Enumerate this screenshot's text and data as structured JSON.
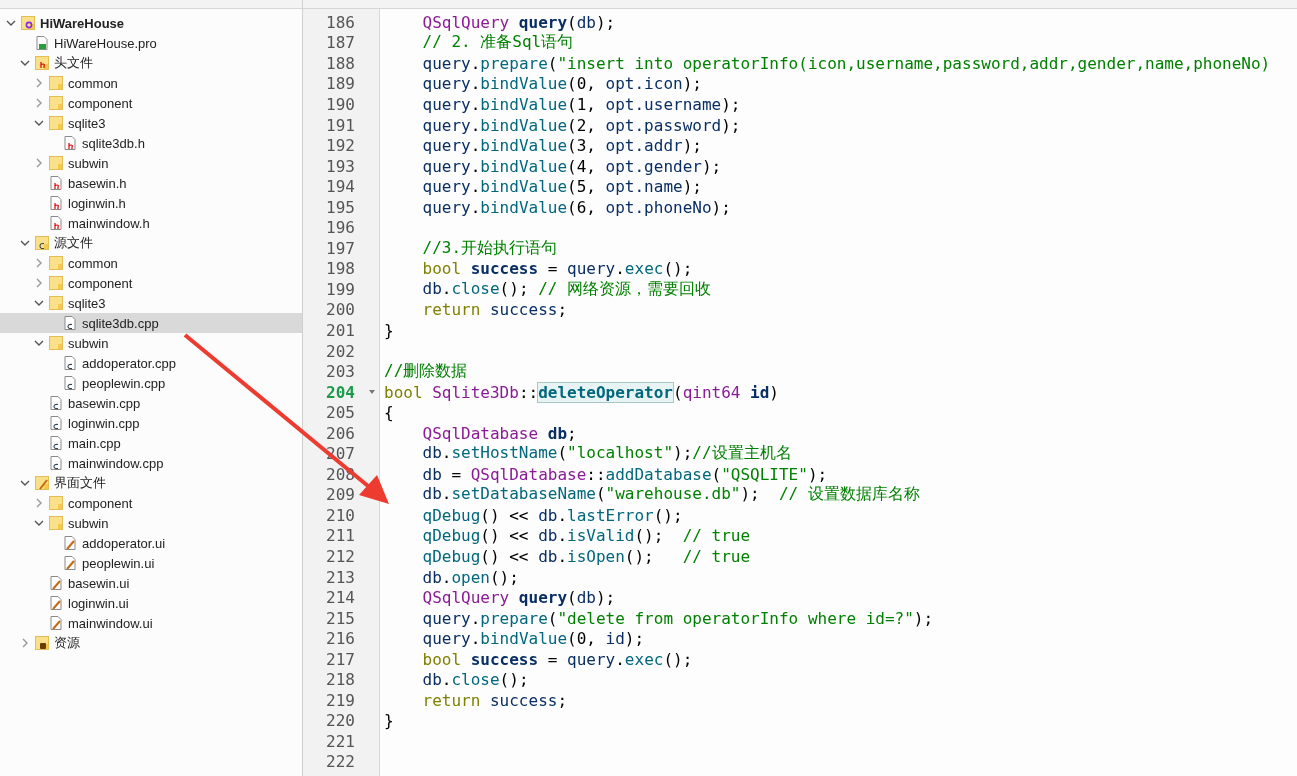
{
  "project_tree": [
    {
      "label": "HiWareHouse",
      "kind": "project",
      "expanded": true,
      "selected": false,
      "children": [
        {
          "label": "HiWareHouse.pro",
          "kind": "pro",
          "selected": false
        },
        {
          "label": "头文件",
          "kind": "headers",
          "expanded": true,
          "selected": false,
          "children": [
            {
              "label": "common",
              "kind": "folder",
              "expanded": false,
              "selected": false
            },
            {
              "label": "component",
              "kind": "folder",
              "expanded": false,
              "selected": false
            },
            {
              "label": "sqlite3",
              "kind": "folder",
              "expanded": true,
              "selected": false,
              "children": [
                {
                  "label": "sqlite3db.h",
                  "kind": "header",
                  "selected": false
                }
              ]
            },
            {
              "label": "subwin",
              "kind": "folder",
              "expanded": false,
              "selected": false
            },
            {
              "label": "basewin.h",
              "kind": "header",
              "selected": false
            },
            {
              "label": "loginwin.h",
              "kind": "header",
              "selected": false
            },
            {
              "label": "mainwindow.h",
              "kind": "header",
              "selected": false
            }
          ]
        },
        {
          "label": "源文件",
          "kind": "sources",
          "expanded": true,
          "selected": false,
          "children": [
            {
              "label": "common",
              "kind": "folder",
              "expanded": false,
              "selected": false
            },
            {
              "label": "component",
              "kind": "folder",
              "expanded": false,
              "selected": false
            },
            {
              "label": "sqlite3",
              "kind": "folder",
              "expanded": true,
              "selected": false,
              "children": [
                {
                  "label": "sqlite3db.cpp",
                  "kind": "source",
                  "selected": true
                }
              ]
            },
            {
              "label": "subwin",
              "kind": "folder",
              "expanded": true,
              "selected": false,
              "children": [
                {
                  "label": "addoperator.cpp",
                  "kind": "source",
                  "selected": false
                },
                {
                  "label": "peoplewin.cpp",
                  "kind": "source",
                  "selected": false
                }
              ]
            },
            {
              "label": "basewin.cpp",
              "kind": "source",
              "selected": false
            },
            {
              "label": "loginwin.cpp",
              "kind": "source",
              "selected": false
            },
            {
              "label": "main.cpp",
              "kind": "source",
              "selected": false
            },
            {
              "label": "mainwindow.cpp",
              "kind": "source",
              "selected": false
            }
          ]
        },
        {
          "label": "界面文件",
          "kind": "forms",
          "expanded": true,
          "selected": false,
          "children": [
            {
              "label": "component",
              "kind": "folder",
              "expanded": false,
              "selected": false
            },
            {
              "label": "subwin",
              "kind": "folder",
              "expanded": true,
              "selected": false,
              "children": [
                {
                  "label": "addoperator.ui",
                  "kind": "form",
                  "selected": false
                },
                {
                  "label": "peoplewin.ui",
                  "kind": "form",
                  "selected": false
                }
              ]
            },
            {
              "label": "basewin.ui",
              "kind": "form",
              "selected": false
            },
            {
              "label": "loginwin.ui",
              "kind": "form",
              "selected": false
            },
            {
              "label": "mainwindow.ui",
              "kind": "form",
              "selected": false
            }
          ]
        },
        {
          "label": "资源",
          "kind": "resources",
          "expanded": false,
          "selected": false
        }
      ]
    }
  ],
  "editor": {
    "lines": [
      {
        "number": "186",
        "current": false,
        "foldable": false,
        "indented": true,
        "tokens": [
          {
            "kind": "type",
            "text": "QSqlQuery "
          },
          {
            "kind": "decl",
            "text": "query"
          },
          {
            "kind": "plain",
            "text": "("
          },
          {
            "kind": "var",
            "text": "db"
          },
          {
            "kind": "plain",
            "text": ");"
          }
        ]
      },
      {
        "number": "187",
        "current": false,
        "foldable": false,
        "indented": true,
        "tokens": [
          {
            "kind": "comment",
            "text": "// 2. 准备Sql语句"
          }
        ]
      },
      {
        "number": "188",
        "current": false,
        "foldable": false,
        "indented": true,
        "tokens": [
          {
            "kind": "var",
            "text": "query"
          },
          {
            "kind": "plain",
            "text": "."
          },
          {
            "kind": "fn",
            "text": "prepare"
          },
          {
            "kind": "plain",
            "text": "("
          },
          {
            "kind": "string",
            "text": "\"insert into operatorInfo(icon,username,password,addr,gender,name,phoneNo)"
          }
        ]
      },
      {
        "number": "189",
        "current": false,
        "foldable": false,
        "indented": true,
        "tokens": [
          {
            "kind": "var",
            "text": "query"
          },
          {
            "kind": "plain",
            "text": "."
          },
          {
            "kind": "fn",
            "text": "bindValue"
          },
          {
            "kind": "plain",
            "text": "(0, "
          },
          {
            "kind": "var",
            "text": "opt.icon"
          },
          {
            "kind": "plain",
            "text": ");"
          }
        ]
      },
      {
        "number": "190",
        "current": false,
        "foldable": false,
        "indented": true,
        "tokens": [
          {
            "kind": "var",
            "text": "query"
          },
          {
            "kind": "plain",
            "text": "."
          },
          {
            "kind": "fn",
            "text": "bindValue"
          },
          {
            "kind": "plain",
            "text": "(1, "
          },
          {
            "kind": "var",
            "text": "opt.username"
          },
          {
            "kind": "plain",
            "text": ");"
          }
        ]
      },
      {
        "number": "191",
        "current": false,
        "foldable": false,
        "indented": true,
        "tokens": [
          {
            "kind": "var",
            "text": "query"
          },
          {
            "kind": "plain",
            "text": "."
          },
          {
            "kind": "fn",
            "text": "bindValue"
          },
          {
            "kind": "plain",
            "text": "(2, "
          },
          {
            "kind": "var",
            "text": "opt.password"
          },
          {
            "kind": "plain",
            "text": ");"
          }
        ]
      },
      {
        "number": "192",
        "current": false,
        "foldable": false,
        "indented": true,
        "tokens": [
          {
            "kind": "var",
            "text": "query"
          },
          {
            "kind": "plain",
            "text": "."
          },
          {
            "kind": "fn",
            "text": "bindValue"
          },
          {
            "kind": "plain",
            "text": "(3, "
          },
          {
            "kind": "var",
            "text": "opt.addr"
          },
          {
            "kind": "plain",
            "text": ");"
          }
        ]
      },
      {
        "number": "193",
        "current": false,
        "foldable": false,
        "indented": true,
        "tokens": [
          {
            "kind": "var",
            "text": "query"
          },
          {
            "kind": "plain",
            "text": "."
          },
          {
            "kind": "fn",
            "text": "bindValue"
          },
          {
            "kind": "plain",
            "text": "(4, "
          },
          {
            "kind": "var",
            "text": "opt.gender"
          },
          {
            "kind": "plain",
            "text": ");"
          }
        ]
      },
      {
        "number": "194",
        "current": false,
        "foldable": false,
        "indented": true,
        "tokens": [
          {
            "kind": "var",
            "text": "query"
          },
          {
            "kind": "plain",
            "text": "."
          },
          {
            "kind": "fn",
            "text": "bindValue"
          },
          {
            "kind": "plain",
            "text": "(5, "
          },
          {
            "kind": "var",
            "text": "opt.name"
          },
          {
            "kind": "plain",
            "text": ");"
          }
        ]
      },
      {
        "number": "195",
        "current": false,
        "foldable": false,
        "indented": true,
        "tokens": [
          {
            "kind": "var",
            "text": "query"
          },
          {
            "kind": "plain",
            "text": "."
          },
          {
            "kind": "fn",
            "text": "bindValue"
          },
          {
            "kind": "plain",
            "text": "(6, "
          },
          {
            "kind": "var",
            "text": "opt.phoneNo"
          },
          {
            "kind": "plain",
            "text": ");"
          }
        ]
      },
      {
        "number": "196",
        "current": false
      },
      {
        "number": "197",
        "current": false,
        "foldable": false,
        "indented": true,
        "tokens": [
          {
            "kind": "comment",
            "text": "//3.开始执行语句"
          }
        ]
      },
      {
        "number": "198",
        "current": false,
        "foldable": false,
        "indented": true,
        "tokens": [
          {
            "kind": "keyword",
            "text": "bool "
          },
          {
            "kind": "decl",
            "text": "success"
          },
          {
            "kind": "plain",
            "text": " = "
          },
          {
            "kind": "var",
            "text": "query"
          },
          {
            "kind": "plain",
            "text": "."
          },
          {
            "kind": "fn",
            "text": "exec"
          },
          {
            "kind": "plain",
            "text": "();"
          }
        ]
      },
      {
        "number": "199",
        "current": false,
        "foldable": false,
        "indented": true,
        "tokens": [
          {
            "kind": "var",
            "text": "db"
          },
          {
            "kind": "plain",
            "text": "."
          },
          {
            "kind": "fn",
            "text": "close"
          },
          {
            "kind": "plain",
            "text": "(); "
          },
          {
            "kind": "comment",
            "text": "// 网络资源，需要回收"
          }
        ]
      },
      {
        "number": "200",
        "current": false,
        "foldable": false,
        "indented": true,
        "tokens": [
          {
            "kind": "keyword",
            "text": "return "
          },
          {
            "kind": "var",
            "text": "success"
          },
          {
            "kind": "plain",
            "text": ";"
          }
        ]
      },
      {
        "number": "201",
        "current": false,
        "foldable": false,
        "indented": false,
        "tokens": [
          {
            "kind": "plain",
            "text": "}"
          }
        ]
      },
      {
        "number": "202",
        "current": false
      },
      {
        "number": "203",
        "current": false,
        "foldable": false,
        "indented": false,
        "tokens": [
          {
            "kind": "comment",
            "text": "//删除数据"
          }
        ]
      },
      {
        "number": "204",
        "current": true,
        "foldable": true,
        "indented": false,
        "tokens": [
          {
            "kind": "keyword",
            "text": "bool "
          },
          {
            "kind": "type",
            "text": "Sqlite3Db"
          },
          {
            "kind": "plain",
            "text": "::"
          },
          {
            "kind": "match",
            "text": "deleteOperator"
          },
          {
            "kind": "plain",
            "text": "("
          },
          {
            "kind": "type",
            "text": "qint64 "
          },
          {
            "kind": "decl",
            "text": "id"
          },
          {
            "kind": "plain",
            "text": ")"
          }
        ]
      },
      {
        "number": "205",
        "current": false,
        "foldable": false,
        "indented": false,
        "tokens": [
          {
            "kind": "plain",
            "text": "{"
          }
        ]
      },
      {
        "number": "206",
        "current": false,
        "foldable": false,
        "indented": true,
        "tokens": [
          {
            "kind": "type",
            "text": "QSqlDatabase "
          },
          {
            "kind": "decl",
            "text": "db"
          },
          {
            "kind": "plain",
            "text": ";"
          }
        ]
      },
      {
        "number": "207",
        "current": false,
        "foldable": false,
        "indented": true,
        "tokens": [
          {
            "kind": "var",
            "text": "db"
          },
          {
            "kind": "plain",
            "text": "."
          },
          {
            "kind": "fn",
            "text": "setHostName"
          },
          {
            "kind": "plain",
            "text": "("
          },
          {
            "kind": "string",
            "text": "\"localhost\""
          },
          {
            "kind": "plain",
            "text": ");"
          },
          {
            "kind": "comment",
            "text": "//设置主机名"
          }
        ]
      },
      {
        "number": "208",
        "current": false,
        "foldable": false,
        "indented": true,
        "tokens": [
          {
            "kind": "var",
            "text": "db"
          },
          {
            "kind": "plain",
            "text": " = "
          },
          {
            "kind": "type",
            "text": "QSqlDatabase"
          },
          {
            "kind": "plain",
            "text": "::"
          },
          {
            "kind": "fn",
            "text": "addDatabase"
          },
          {
            "kind": "plain",
            "text": "("
          },
          {
            "kind": "string",
            "text": "\"QSQLITE\""
          },
          {
            "kind": "plain",
            "text": ");"
          }
        ]
      },
      {
        "number": "209",
        "current": false,
        "foldable": false,
        "indented": true,
        "tokens": [
          {
            "kind": "var",
            "text": "db"
          },
          {
            "kind": "plain",
            "text": "."
          },
          {
            "kind": "fn",
            "text": "setDatabaseName"
          },
          {
            "kind": "plain",
            "text": "("
          },
          {
            "kind": "string",
            "text": "\"warehouse.db\""
          },
          {
            "kind": "plain",
            "text": ");  "
          },
          {
            "kind": "comment",
            "text": "// 设置数据库名称"
          }
        ]
      },
      {
        "number": "210",
        "current": false,
        "foldable": false,
        "indented": true,
        "tokens": [
          {
            "kind": "fn",
            "text": "qDebug"
          },
          {
            "kind": "plain",
            "text": "() << "
          },
          {
            "kind": "var",
            "text": "db"
          },
          {
            "kind": "plain",
            "text": "."
          },
          {
            "kind": "fn",
            "text": "lastError"
          },
          {
            "kind": "plain",
            "text": "();"
          }
        ]
      },
      {
        "number": "211",
        "current": false,
        "foldable": false,
        "indented": true,
        "tokens": [
          {
            "kind": "fn",
            "text": "qDebug"
          },
          {
            "kind": "plain",
            "text": "() << "
          },
          {
            "kind": "var",
            "text": "db"
          },
          {
            "kind": "plain",
            "text": "."
          },
          {
            "kind": "fn",
            "text": "isValid"
          },
          {
            "kind": "plain",
            "text": "();  "
          },
          {
            "kind": "comment",
            "text": "// true"
          }
        ]
      },
      {
        "number": "212",
        "current": false,
        "foldable": false,
        "indented": true,
        "tokens": [
          {
            "kind": "fn",
            "text": "qDebug"
          },
          {
            "kind": "plain",
            "text": "() << "
          },
          {
            "kind": "var",
            "text": "db"
          },
          {
            "kind": "plain",
            "text": "."
          },
          {
            "kind": "fn",
            "text": "isOpen"
          },
          {
            "kind": "plain",
            "text": "();   "
          },
          {
            "kind": "comment",
            "text": "// true"
          }
        ]
      },
      {
        "number": "213",
        "current": false,
        "foldable": false,
        "indented": true,
        "tokens": [
          {
            "kind": "var",
            "text": "db"
          },
          {
            "kind": "plain",
            "text": "."
          },
          {
            "kind": "fn",
            "text": "open"
          },
          {
            "kind": "plain",
            "text": "();"
          }
        ]
      },
      {
        "number": "214",
        "current": false,
        "foldable": false,
        "indented": true,
        "tokens": [
          {
            "kind": "type",
            "text": "QSqlQuery "
          },
          {
            "kind": "decl",
            "text": "query"
          },
          {
            "kind": "plain",
            "text": "("
          },
          {
            "kind": "var",
            "text": "db"
          },
          {
            "kind": "plain",
            "text": ");"
          }
        ]
      },
      {
        "number": "215",
        "current": false,
        "foldable": false,
        "indented": true,
        "tokens": [
          {
            "kind": "var",
            "text": "query"
          },
          {
            "kind": "plain",
            "text": "."
          },
          {
            "kind": "fn",
            "text": "prepare"
          },
          {
            "kind": "plain",
            "text": "("
          },
          {
            "kind": "string",
            "text": "\"delete from operatorInfo where id=?\""
          },
          {
            "kind": "plain",
            "text": ");"
          }
        ]
      },
      {
        "number": "216",
        "current": false,
        "foldable": false,
        "indented": true,
        "tokens": [
          {
            "kind": "var",
            "text": "query"
          },
          {
            "kind": "plain",
            "text": "."
          },
          {
            "kind": "fn",
            "text": "bindValue"
          },
          {
            "kind": "plain",
            "text": "(0, "
          },
          {
            "kind": "var",
            "text": "id"
          },
          {
            "kind": "plain",
            "text": ");"
          }
        ]
      },
      {
        "number": "217",
        "current": false,
        "foldable": false,
        "indented": true,
        "tokens": [
          {
            "kind": "keyword",
            "text": "bool "
          },
          {
            "kind": "decl",
            "text": "success"
          },
          {
            "kind": "plain",
            "text": " = "
          },
          {
            "kind": "var",
            "text": "query"
          },
          {
            "kind": "plain",
            "text": "."
          },
          {
            "kind": "fn",
            "text": "exec"
          },
          {
            "kind": "plain",
            "text": "();"
          }
        ]
      },
      {
        "number": "218",
        "current": false,
        "foldable": false,
        "indented": true,
        "tokens": [
          {
            "kind": "var",
            "text": "db"
          },
          {
            "kind": "plain",
            "text": "."
          },
          {
            "kind": "fn",
            "text": "close"
          },
          {
            "kind": "plain",
            "text": "();"
          }
        ]
      },
      {
        "number": "219",
        "current": false,
        "foldable": false,
        "indented": true,
        "tokens": [
          {
            "kind": "keyword",
            "text": "return "
          },
          {
            "kind": "var",
            "text": "success"
          },
          {
            "kind": "plain",
            "text": ";"
          }
        ]
      },
      {
        "number": "220",
        "current": false,
        "foldable": false,
        "indented": false,
        "tokens": [
          {
            "kind": "plain",
            "text": "}"
          }
        ]
      },
      {
        "number": "221",
        "current": false
      },
      {
        "number": "222",
        "current": false
      }
    ]
  }
}
